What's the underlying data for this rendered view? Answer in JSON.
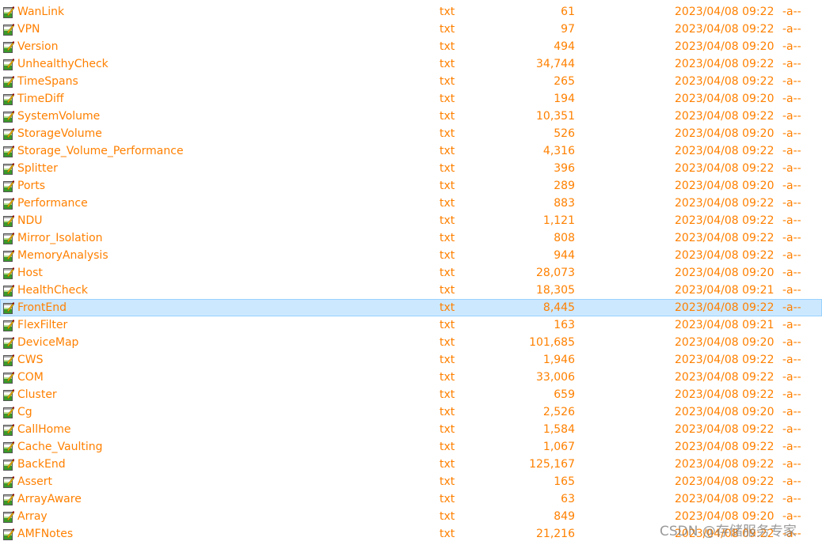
{
  "accent_color": "#ff8000",
  "selected_index": 18,
  "files": [
    {
      "name": "",
      "type": "",
      "size": "",
      "date": "",
      "attr": ""
    },
    {
      "name": "WanLink",
      "type": "txt",
      "size": "61",
      "date": "2023/04/08 09:22",
      "attr": "-a--"
    },
    {
      "name": "VPN",
      "type": "txt",
      "size": "97",
      "date": "2023/04/08 09:22",
      "attr": "-a--"
    },
    {
      "name": "Version",
      "type": "txt",
      "size": "494",
      "date": "2023/04/08 09:20",
      "attr": "-a--"
    },
    {
      "name": "UnhealthyCheck",
      "type": "txt",
      "size": "34,744",
      "date": "2023/04/08 09:22",
      "attr": "-a--"
    },
    {
      "name": "TimeSpans",
      "type": "txt",
      "size": "265",
      "date": "2023/04/08 09:22",
      "attr": "-a--"
    },
    {
      "name": "TimeDiff",
      "type": "txt",
      "size": "194",
      "date": "2023/04/08 09:20",
      "attr": "-a--"
    },
    {
      "name": "SystemVolume",
      "type": "txt",
      "size": "10,351",
      "date": "2023/04/08 09:22",
      "attr": "-a--"
    },
    {
      "name": "StorageVolume",
      "type": "txt",
      "size": "526",
      "date": "2023/04/08 09:20",
      "attr": "-a--"
    },
    {
      "name": "Storage_Volume_Performance",
      "type": "txt",
      "size": "4,316",
      "date": "2023/04/08 09:22",
      "attr": "-a--"
    },
    {
      "name": "Splitter",
      "type": "txt",
      "size": "396",
      "date": "2023/04/08 09:22",
      "attr": "-a--"
    },
    {
      "name": "Ports",
      "type": "txt",
      "size": "289",
      "date": "2023/04/08 09:20",
      "attr": "-a--"
    },
    {
      "name": "Performance",
      "type": "txt",
      "size": "883",
      "date": "2023/04/08 09:22",
      "attr": "-a--"
    },
    {
      "name": "NDU",
      "type": "txt",
      "size": "1,121",
      "date": "2023/04/08 09:22",
      "attr": "-a--"
    },
    {
      "name": "Mirror_Isolation",
      "type": "txt",
      "size": "808",
      "date": "2023/04/08 09:22",
      "attr": "-a--"
    },
    {
      "name": "MemoryAnalysis",
      "type": "txt",
      "size": "944",
      "date": "2023/04/08 09:22",
      "attr": "-a--"
    },
    {
      "name": "Host",
      "type": "txt",
      "size": "28,073",
      "date": "2023/04/08 09:20",
      "attr": "-a--"
    },
    {
      "name": "HealthCheck",
      "type": "txt",
      "size": "18,305",
      "date": "2023/04/08 09:21",
      "attr": "-a--"
    },
    {
      "name": "FrontEnd",
      "type": "txt",
      "size": "8,445",
      "date": "2023/04/08 09:22",
      "attr": "-a--"
    },
    {
      "name": "FlexFilter",
      "type": "txt",
      "size": "163",
      "date": "2023/04/08 09:21",
      "attr": "-a--"
    },
    {
      "name": "DeviceMap",
      "type": "txt",
      "size": "101,685",
      "date": "2023/04/08 09:20",
      "attr": "-a--"
    },
    {
      "name": "CWS",
      "type": "txt",
      "size": "1,946",
      "date": "2023/04/08 09:22",
      "attr": "-a--"
    },
    {
      "name": "COM",
      "type": "txt",
      "size": "33,006",
      "date": "2023/04/08 09:22",
      "attr": "-a--"
    },
    {
      "name": "Cluster",
      "type": "txt",
      "size": "659",
      "date": "2023/04/08 09:22",
      "attr": "-a--"
    },
    {
      "name": "Cg",
      "type": "txt",
      "size": "2,526",
      "date": "2023/04/08 09:20",
      "attr": "-a--"
    },
    {
      "name": "CallHome",
      "type": "txt",
      "size": "1,584",
      "date": "2023/04/08 09:22",
      "attr": "-a--"
    },
    {
      "name": "Cache_Vaulting",
      "type": "txt",
      "size": "1,067",
      "date": "2023/04/08 09:22",
      "attr": "-a--"
    },
    {
      "name": "BackEnd",
      "type": "txt",
      "size": "125,167",
      "date": "2023/04/08 09:22",
      "attr": "-a--"
    },
    {
      "name": "Assert",
      "type": "txt",
      "size": "165",
      "date": "2023/04/08 09:22",
      "attr": "-a--"
    },
    {
      "name": "ArrayAware",
      "type": "txt",
      "size": "63",
      "date": "2023/04/08 09:22",
      "attr": "-a--"
    },
    {
      "name": "Array",
      "type": "txt",
      "size": "849",
      "date": "2023/04/08 09:20",
      "attr": "-a--"
    },
    {
      "name": "AMFNotes",
      "type": "txt",
      "size": "21,216",
      "date": "2023/04/08 09:22",
      "attr": "-a--"
    }
  ],
  "watermark": "CSDN @存储服务专家"
}
